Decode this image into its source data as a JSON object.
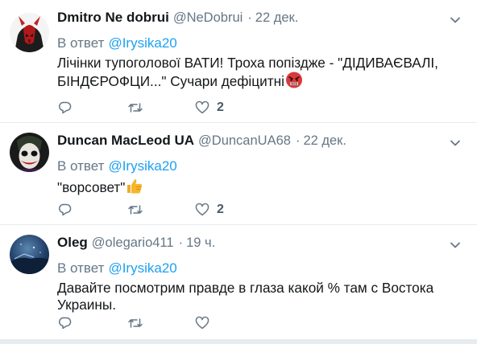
{
  "tweets": [
    {
      "name": "Dmitro Ne dobrui",
      "handle": "@NeDobrui",
      "dot": "·",
      "time": "22 дек.",
      "reply_prefix": "В ответ",
      "reply_mention": "@Irysika20",
      "text": "Лічінки тупоголової ВАТИ! Троха попіздже - \"ДІДИВАЄВАЛІ, БІНДЄРОФЦИ...\" Сучари дефіцитні",
      "emoji": "angry-face-icon",
      "likes": "2"
    },
    {
      "name": "Duncan MacLeod UA",
      "handle": "@DuncanUA68",
      "dot": "·",
      "time": "22 дек.",
      "reply_prefix": "В ответ",
      "reply_mention": "@Irysika20",
      "text": "\"ворсовет\"",
      "emoji": "thumbs-up-icon",
      "likes": "2"
    },
    {
      "name": "Oleg",
      "handle": "@olegario411",
      "dot": "·",
      "time": "19 ч.",
      "reply_prefix": "В ответ",
      "reply_mention": "@Irysika20",
      "text": "Давайте посмотрим правде в глаза какой % там с Востока Украины.",
      "likes": ""
    }
  ],
  "colors": {
    "text": "#14171a",
    "secondary": "#657786",
    "accent": "#1da1f2",
    "divider": "#e6ecf0"
  }
}
